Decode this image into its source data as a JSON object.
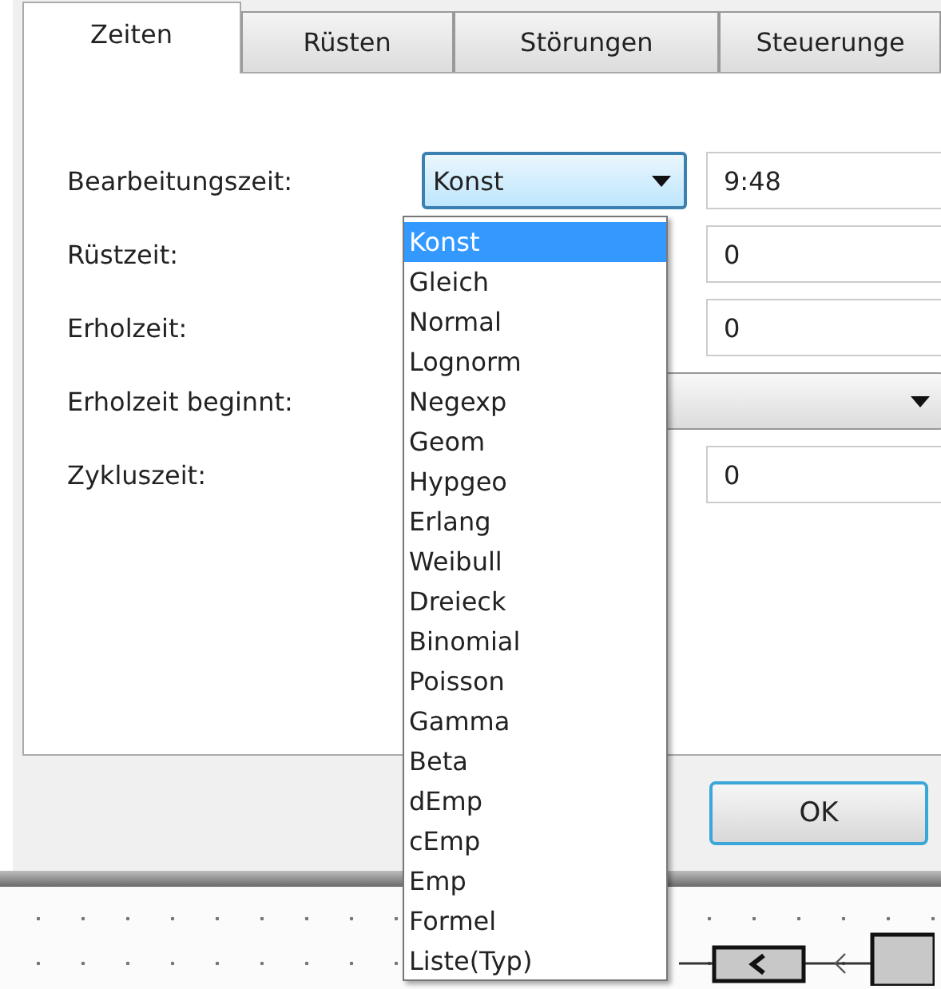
{
  "tabs": [
    {
      "label": "Zeiten",
      "selected": true
    },
    {
      "label": "Rüsten",
      "selected": false
    },
    {
      "label": "Störungen",
      "selected": false
    },
    {
      "label": "Steuerunge",
      "selected": false
    }
  ],
  "rows": [
    {
      "label": "Bearbeitungszeit:",
      "kind": "timed",
      "distribution": "Konst",
      "focused": true,
      "value": "9:48"
    },
    {
      "label": "Rüstzeit:",
      "kind": "timed",
      "value": "0"
    },
    {
      "label": "Erholzeit:",
      "kind": "timed",
      "value": "0"
    },
    {
      "label": "Erholzeit beginnt:",
      "kind": "select"
    },
    {
      "label": "Zykluszeit:",
      "kind": "timed",
      "value": "0"
    }
  ],
  "dropdown": {
    "open": true,
    "options": [
      {
        "label": "Konst",
        "selected": true
      },
      {
        "label": "Gleich",
        "selected": false
      },
      {
        "label": "Normal",
        "selected": false
      },
      {
        "label": "Lognorm",
        "selected": false
      },
      {
        "label": "Negexp",
        "selected": false
      },
      {
        "label": "Geom",
        "selected": false
      },
      {
        "label": "Hypgeo",
        "selected": false
      },
      {
        "label": "Erlang",
        "selected": false
      },
      {
        "label": "Weibull",
        "selected": false
      },
      {
        "label": "Dreieck",
        "selected": false
      },
      {
        "label": "Binomial",
        "selected": false
      },
      {
        "label": "Poisson",
        "selected": false
      },
      {
        "label": "Gamma",
        "selected": false
      },
      {
        "label": "Beta",
        "selected": false
      },
      {
        "label": "dEmp",
        "selected": false
      },
      {
        "label": "cEmp",
        "selected": false
      },
      {
        "label": "Emp",
        "selected": false
      },
      {
        "label": "Formel",
        "selected": false
      },
      {
        "label": "Liste(Typ)",
        "selected": false
      }
    ]
  },
  "buttons": [
    {
      "label": "OK",
      "default": true
    }
  ]
}
